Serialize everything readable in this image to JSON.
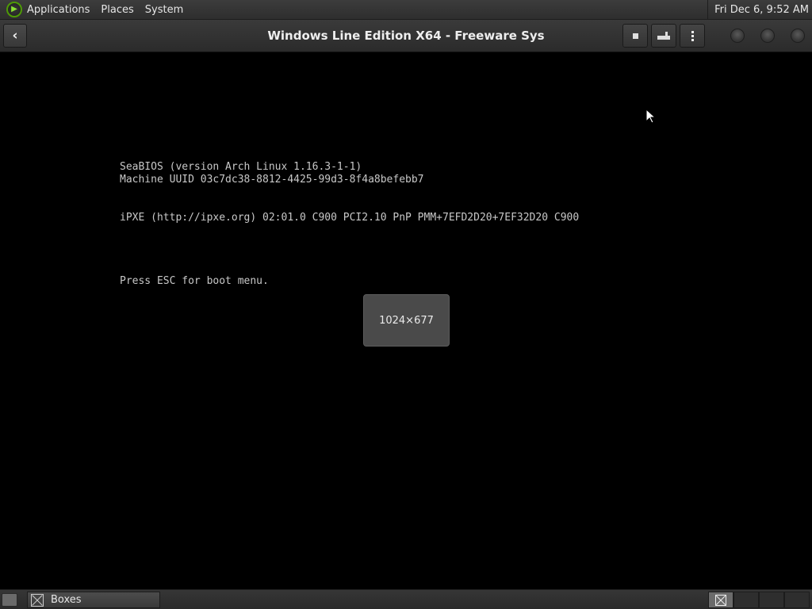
{
  "top_panel": {
    "menus": [
      "Applications",
      "Places",
      "System"
    ],
    "clock": "Fri Dec 6,  9:52 AM"
  },
  "header": {
    "title": "Windows Line Edition X64 - Freeware Sys",
    "back_icon": "back-arrow-icon",
    "buttons": [
      "stop-icon",
      "keyboard-icon",
      "menu-icon"
    ],
    "window_controls": [
      "minimize",
      "maximize",
      "close"
    ]
  },
  "vm_screen": {
    "lines": [
      "SeaBIOS (version Arch Linux 1.16.3-1-1)",
      "Machine UUID 03c7dc38-8812-4425-99d3-8f4a8befebb7",
      "iPXE (http://ipxe.org) 02:01.0 C900 PCI2.10 PnP PMM+7EFD2D20+7EF32D20 C900",
      "Press ESC for boot menu."
    ],
    "resolution_overlay": "1024×677"
  },
  "taskbar": {
    "task_label": "Boxes"
  }
}
